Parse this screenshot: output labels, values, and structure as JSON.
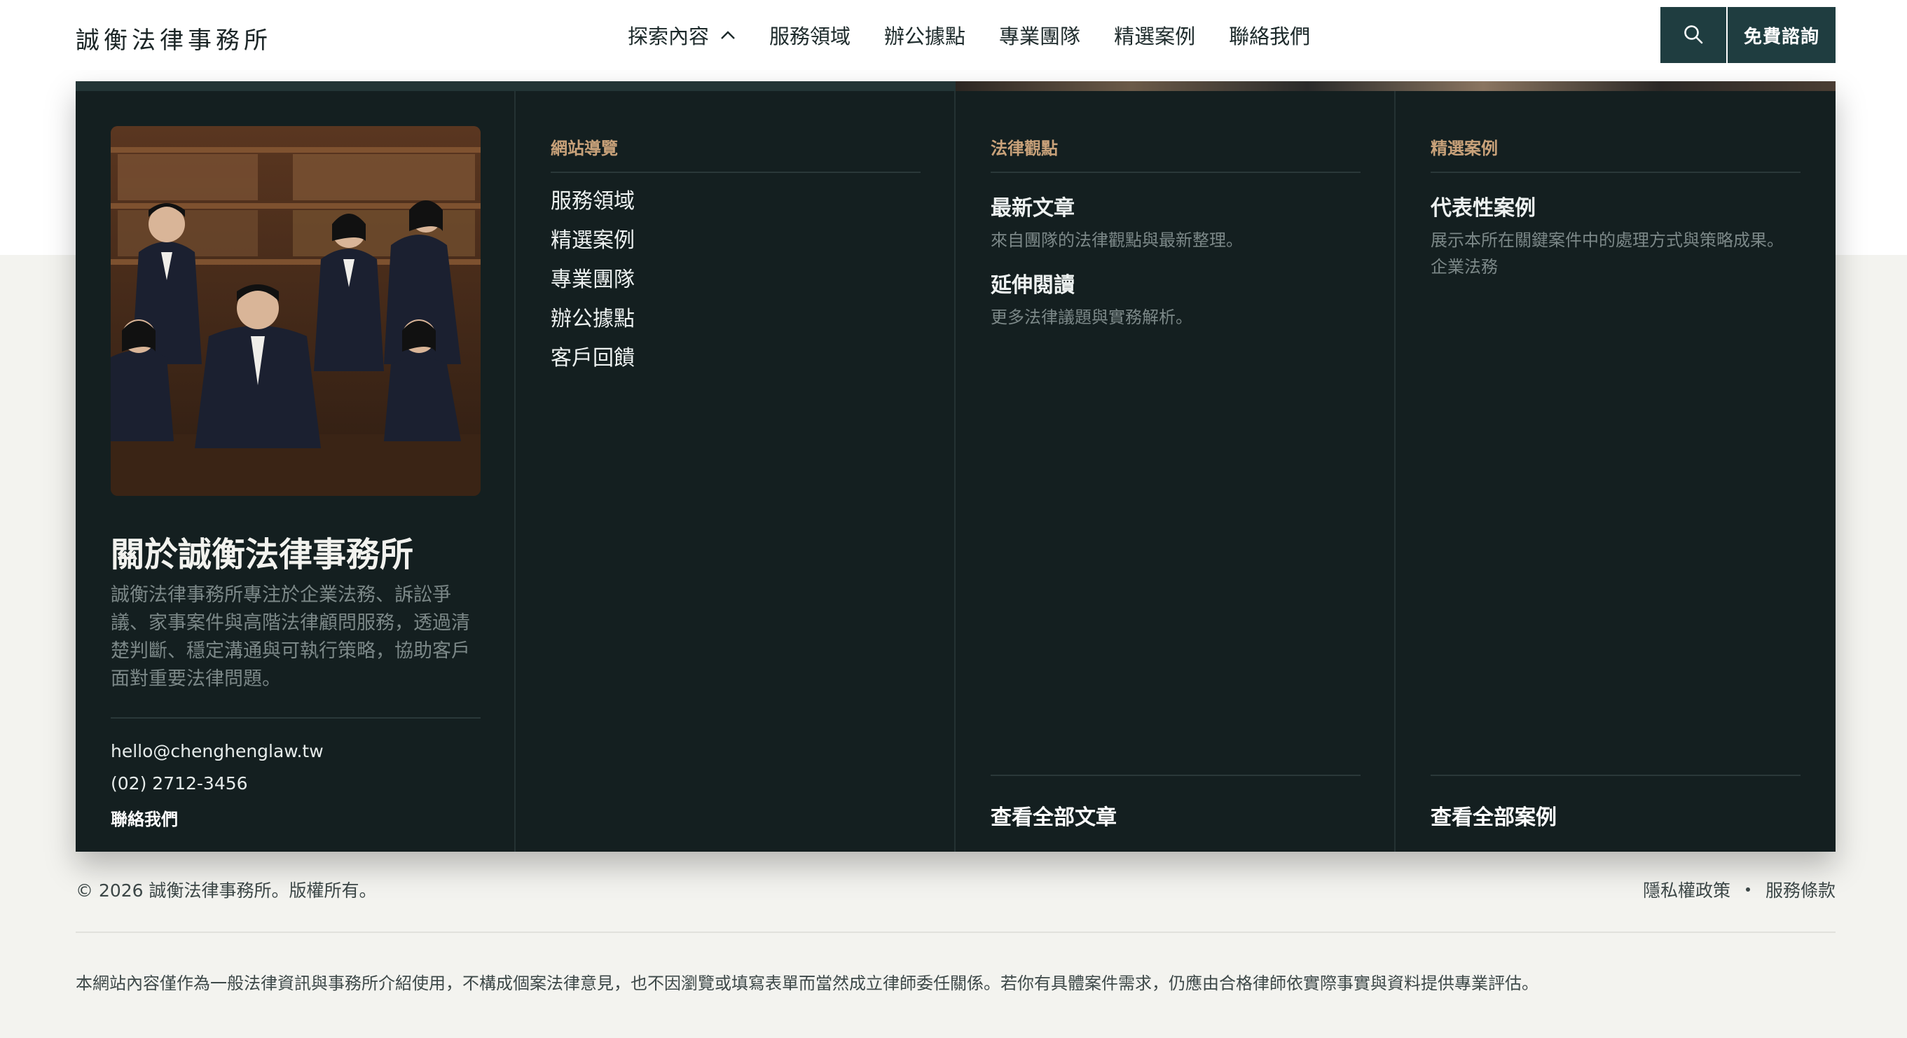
{
  "brand": {
    "name": "誠衡法律事務所"
  },
  "nav": {
    "items": [
      {
        "label": "探索內容"
      },
      {
        "label": "服務領域"
      },
      {
        "label": "辦公據點"
      },
      {
        "label": "專業團隊"
      },
      {
        "label": "精選案例"
      },
      {
        "label": "聯絡我們"
      }
    ],
    "search_icon": "search-icon",
    "consult_label": "免費諮詢"
  },
  "mega": {
    "about": {
      "title": "關於誠衡法律事務所",
      "description": "誠衡法律事務所專注於企業法務、訴訟爭議、家事案件與高階法律顧問服務，透過清楚判斷、穩定溝通與可執行策略，協助客戶面對重要法律問題。",
      "email": "hello@chenghenglaw.tw",
      "phone": "(02) 2712-3456",
      "contact_label": "聯絡我們"
    },
    "site_nav": {
      "heading": "網站導覽",
      "items": [
        "服務領域",
        "精選案例",
        "專業團隊",
        "辦公據點",
        "客戶回饋"
      ]
    },
    "insights": {
      "heading": "法律觀點",
      "entries": [
        {
          "title": "最新文章",
          "desc": "來自團隊的法律觀點與最新整理。"
        },
        {
          "title": "延伸閱讀",
          "desc": "更多法律議題與實務解析。"
        }
      ],
      "footer_link": "查看全部文章"
    },
    "cases": {
      "heading": "精選案例",
      "entries": [
        {
          "title": "代表性案例",
          "desc": "展示本所在關鍵案件中的處理方式與策略成果。",
          "tag": "企業法務"
        }
      ],
      "footer_link": "查看全部案例"
    }
  },
  "footer": {
    "copyright": "© 2026 誠衡法律事務所。版權所有。",
    "privacy": "隱私權政策",
    "terms": "服務條款",
    "disclaimer": "本網站內容僅作為一般法律資訊與事務所介紹使用，不構成個案法律意見，也不因瀏覽或填寫表單而當然成立律師委任關係。若你有具體案件需求，仍應由合格律師依實際事實與資料提供專業評估。"
  }
}
